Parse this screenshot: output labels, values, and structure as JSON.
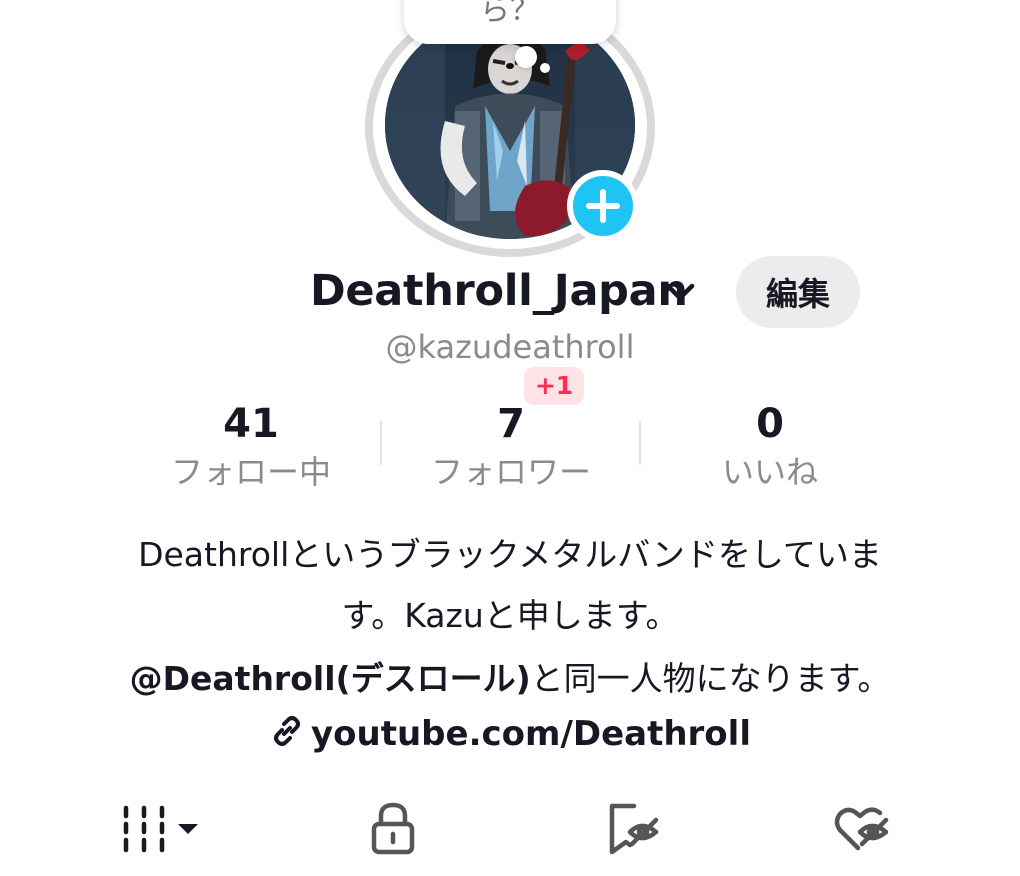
{
  "bubble": {
    "text": "ら？"
  },
  "profile": {
    "display_name": "Deathroll_Japan",
    "edit_label": "編集",
    "handle": "@kazudeathroll"
  },
  "stats": {
    "following": {
      "value": "41",
      "label": "フォロー中"
    },
    "followers": {
      "value": "7",
      "label": "フォロワー",
      "badge": "+1"
    },
    "likes": {
      "value": "0",
      "label": "いいね"
    }
  },
  "bio": {
    "line1": "Deathrollというブラックメタルバンドをしていま",
    "line2": "す。Kazuと申します。",
    "line3_mention": "@Deathroll(デスロール)",
    "line3_rest": "と同一人物になります。",
    "link": "youtube.com/Deathroll"
  },
  "tabs": [
    {
      "icon": "grid-icon",
      "name": "videos"
    },
    {
      "icon": "lock-icon",
      "name": "private"
    },
    {
      "icon": "bookmark-hidden-icon",
      "name": "favorites"
    },
    {
      "icon": "heart-hidden-icon",
      "name": "liked"
    }
  ],
  "colors": {
    "accent_plus": "#20c4f4",
    "badge_text": "#fe2c55",
    "badge_bg": "#fde2e6",
    "secondary_text": "#8a8b91"
  }
}
